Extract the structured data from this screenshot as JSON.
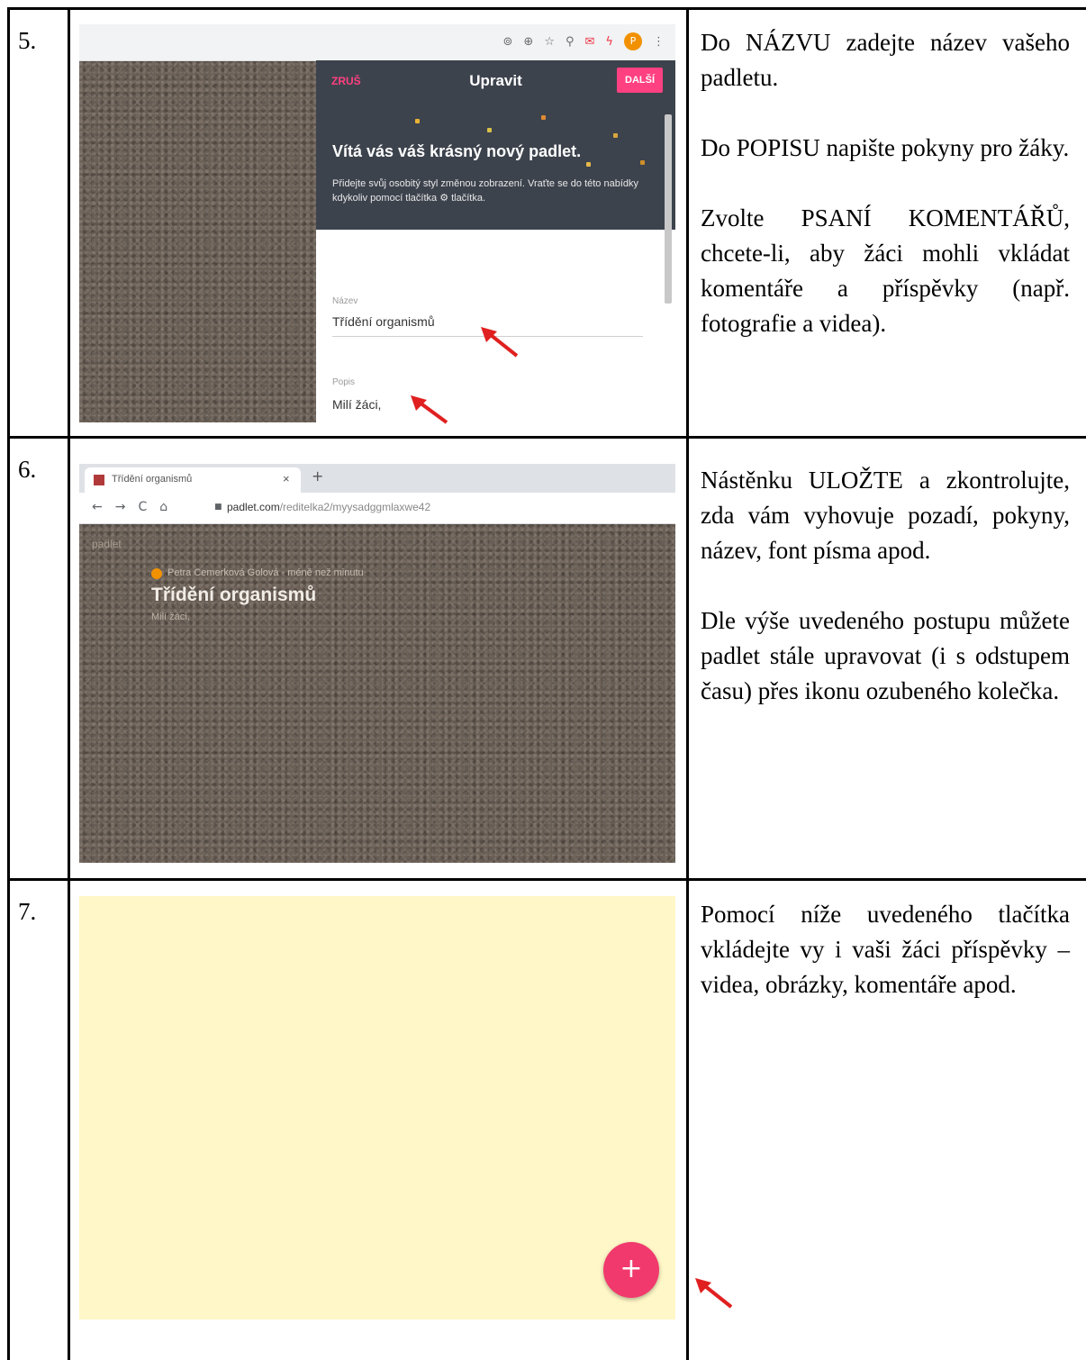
{
  "rows": [
    {
      "number": "5.",
      "paragraphs": [
        "Do NÁZVU zadejte název vašeho padletu.",
        "Do POPISU napište pokyny pro žáky.",
        "Zvolte PSANÍ KOMENTÁŘŮ, chcete-li, aby žáci mohli vkládat komentáře a příspěvky (např. fotografie a videa)."
      ],
      "screenshot": {
        "cancel_label": "ZRUŠ",
        "panel_title": "Upravit",
        "next_label": "DALŠÍ",
        "welcome_title": "Vítá vás váš krásný nový padlet.",
        "welcome_text": "Přidejte svůj osobitý styl změnou zobrazení. Vraťte se do této nabídky kdykoliv pomocí tlačítka ⚙ tlačítka.",
        "name_label": "Název",
        "name_value": "Třídění organismů",
        "description_label": "Popis",
        "description_value": "Milí žáci,"
      }
    },
    {
      "number": "6.",
      "paragraphs": [
        "Nástěnku ULOŽTE a zkontrolujte, zda vám vyhovuje pozadí, pokyny, název, font písma apod.",
        "Dle výše uvedeného postupu můžete padlet stále upravovat (i s odstupem času) přes ikonu ozubeného kolečka."
      ],
      "screenshot": {
        "tab_title": "Třídění organismů",
        "url_domain": "padlet.com",
        "url_path": "/reditelka2/myysadggmlaxwe42",
        "brand": "padlet",
        "author": "Petra Cemerková Golová · méně než minutu",
        "board_title": "Třídění organismů",
        "board_description": "Milí žáci,"
      }
    },
    {
      "number": "7.",
      "paragraphs": [
        "Pomocí níže uvedeného tlačítka vkládejte vy i vaši žáci příspěvky – videa, obrázky, komentáře apod."
      ],
      "screenshot": {
        "fab_label": "+"
      }
    }
  ],
  "colors": {
    "padlet_pink": "#ff4081",
    "panel_dark": "#3d434d",
    "board_brown": "#6a5f55",
    "board_yellow": "#fff7c7",
    "arrow_red": "#e02020"
  }
}
